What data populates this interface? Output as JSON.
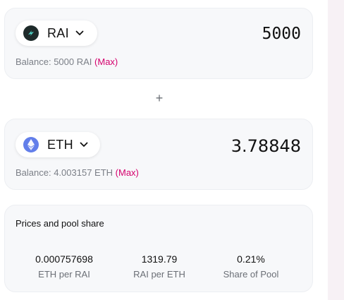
{
  "token_a": {
    "symbol": "RAI",
    "icon": "rai-token-icon",
    "amount": "5000",
    "balance_label": "Balance: 5000 RAI",
    "max_label": "(Max)"
  },
  "separator": {
    "symbol": "+"
  },
  "token_b": {
    "symbol": "ETH",
    "icon": "eth-token-icon",
    "amount": "3.78848",
    "balance_label": "Balance: 4.003157 ETH",
    "max_label": "(Max)"
  },
  "pool": {
    "title": "Prices and pool share",
    "stats": [
      {
        "value": "0.000757698",
        "label": "ETH per RAI"
      },
      {
        "value": "1319.79",
        "label": "RAI per ETH"
      },
      {
        "value": "0.21%",
        "label": "Share of Pool"
      }
    ]
  },
  "colors": {
    "accent": "#d5006d",
    "card_bg": "#f7f8fa",
    "eth_logo": "#627eea",
    "rai_logo": "#1e2a2a"
  }
}
